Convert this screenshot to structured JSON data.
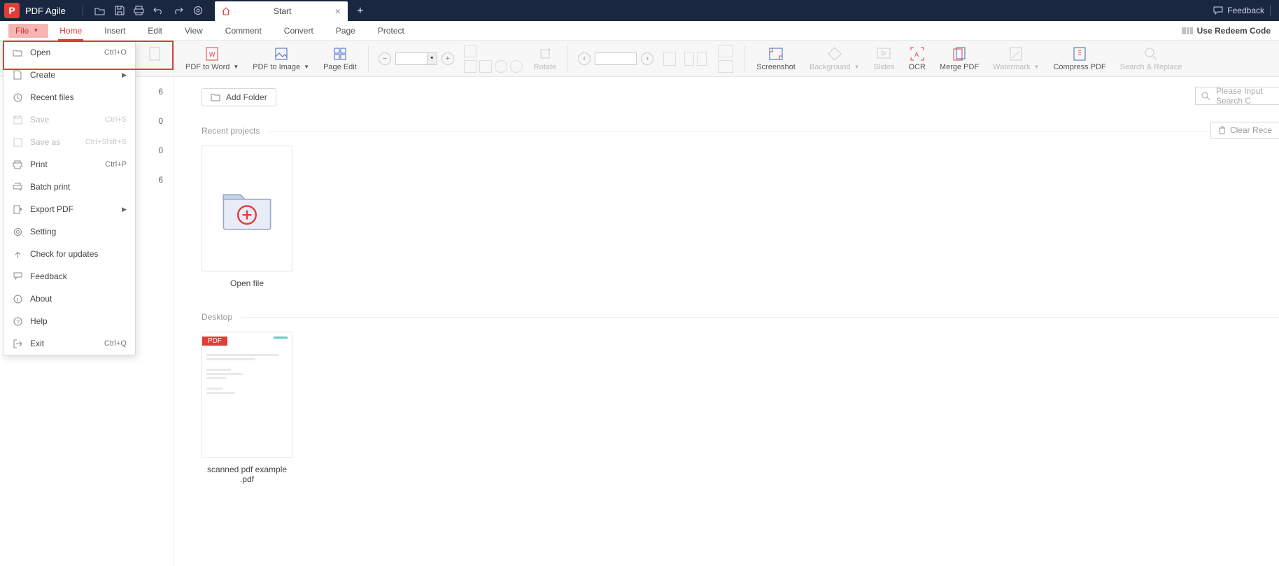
{
  "app": {
    "name": "PDF Agile"
  },
  "titlebar": {
    "feedback": "Feedback",
    "tab": {
      "title": "Start"
    },
    "addtab_tooltip": "+"
  },
  "menubar": {
    "file": "File",
    "tabs": [
      "Home",
      "Insert",
      "Edit",
      "View",
      "Comment",
      "Convert",
      "Page",
      "Protect"
    ],
    "redeem": "Use Redeem Code"
  },
  "ribbon": {
    "pdf_to_word": "PDF to Word",
    "pdf_to_image": "PDF to Image",
    "page_edit": "Page Edit",
    "rotate": "Rotate",
    "screenshot": "Screenshot",
    "background": "Background",
    "slides": "Slides",
    "ocr": "OCR",
    "merge_pdf": "Merge PDF",
    "watermark": "Watermark",
    "compress_pdf": "Compress PDF",
    "search_replace": "Search & Replace"
  },
  "filemenu": {
    "open": {
      "label": "Open",
      "shortcut": "Ctrl+O"
    },
    "create": {
      "label": "Create"
    },
    "recent": {
      "label": "Recent files"
    },
    "save": {
      "label": "Save",
      "shortcut": "Ctrl+S"
    },
    "saveas": {
      "label": "Save as",
      "shortcut": "Ctrl+Shift+S"
    },
    "print": {
      "label": "Print",
      "shortcut": "Ctrl+P"
    },
    "batch": {
      "label": "Batch print"
    },
    "export": {
      "label": "Export PDF"
    },
    "setting": {
      "label": "Setting"
    },
    "updates": {
      "label": "Check for updates"
    },
    "feedback": {
      "label": "Feedback"
    },
    "about": {
      "label": "About"
    },
    "help": {
      "label": "Help"
    },
    "exit": {
      "label": "Exit",
      "shortcut": "Ctrl+Q"
    }
  },
  "sidepanel": {
    "counts": [
      "6",
      "0",
      "0",
      "6"
    ]
  },
  "main": {
    "add_folder": "Add Folder",
    "search_placeholder": "Please Input Search C",
    "recent_projects": "Recent projects",
    "clear_recent": "Clear Rece",
    "open_file": "Open file",
    "desktop": "Desktop",
    "desktop_file": "scanned pdf example .pdf",
    "pdf_badge": "PDF"
  }
}
